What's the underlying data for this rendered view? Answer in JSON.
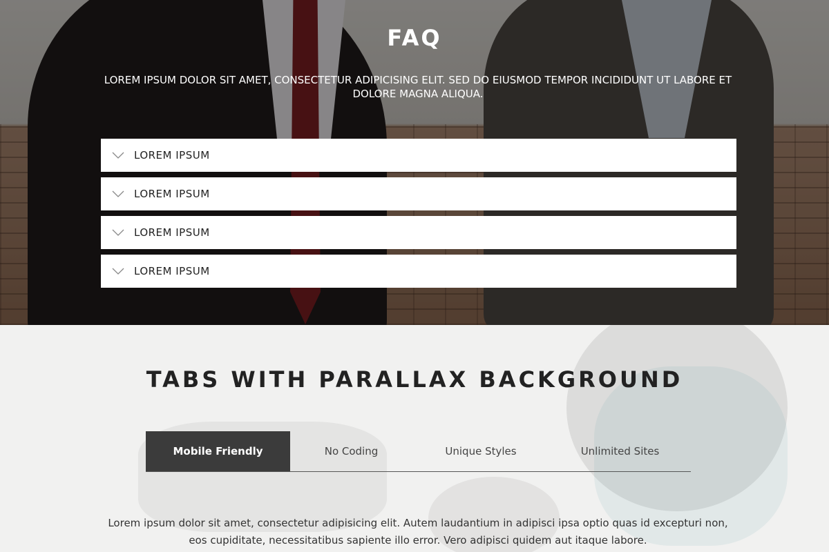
{
  "faq": {
    "title": "FAQ",
    "subtitle": "LOREM IPSUM DOLOR SIT AMET, CONSECTETUR ADIPICISING ELIT. SED DO EIUSMOD TEMPOR INCIDIDUNT UT LABORE ET DOLORE MAGNA ALIQUA.",
    "items": [
      {
        "question": "LOREM IPSUM",
        "icon": "chevron-down-icon"
      },
      {
        "question": "LOREM IPSUM",
        "icon": "chevron-down-icon"
      },
      {
        "question": "LOREM IPSUM",
        "icon": "chevron-down-icon"
      },
      {
        "question": "LOREM IPSUM",
        "icon": "chevron-down-icon"
      }
    ]
  },
  "tabs_section": {
    "title": "TABS WITH PARALLAX BACKGROUND",
    "tabs": [
      {
        "label": "Mobile Friendly",
        "active": true
      },
      {
        "label": "No Coding",
        "active": false
      },
      {
        "label": "Unique Styles",
        "active": false
      },
      {
        "label": "Unlimited Sites",
        "active": false
      }
    ],
    "content": "Lorem ipsum dolor sit amet, consectetur adipisicing elit. Autem laudantium in adipisci ipsa optio quas id excepturi non, eos cupiditate, necessitatibus sapiente illo error. Vero adipisci quidem aut itaque labore."
  },
  "colors": {
    "active_tab_bg": "#3b3b3b",
    "faq_item_bg": "#ffffff",
    "title_dark": "#222222"
  }
}
